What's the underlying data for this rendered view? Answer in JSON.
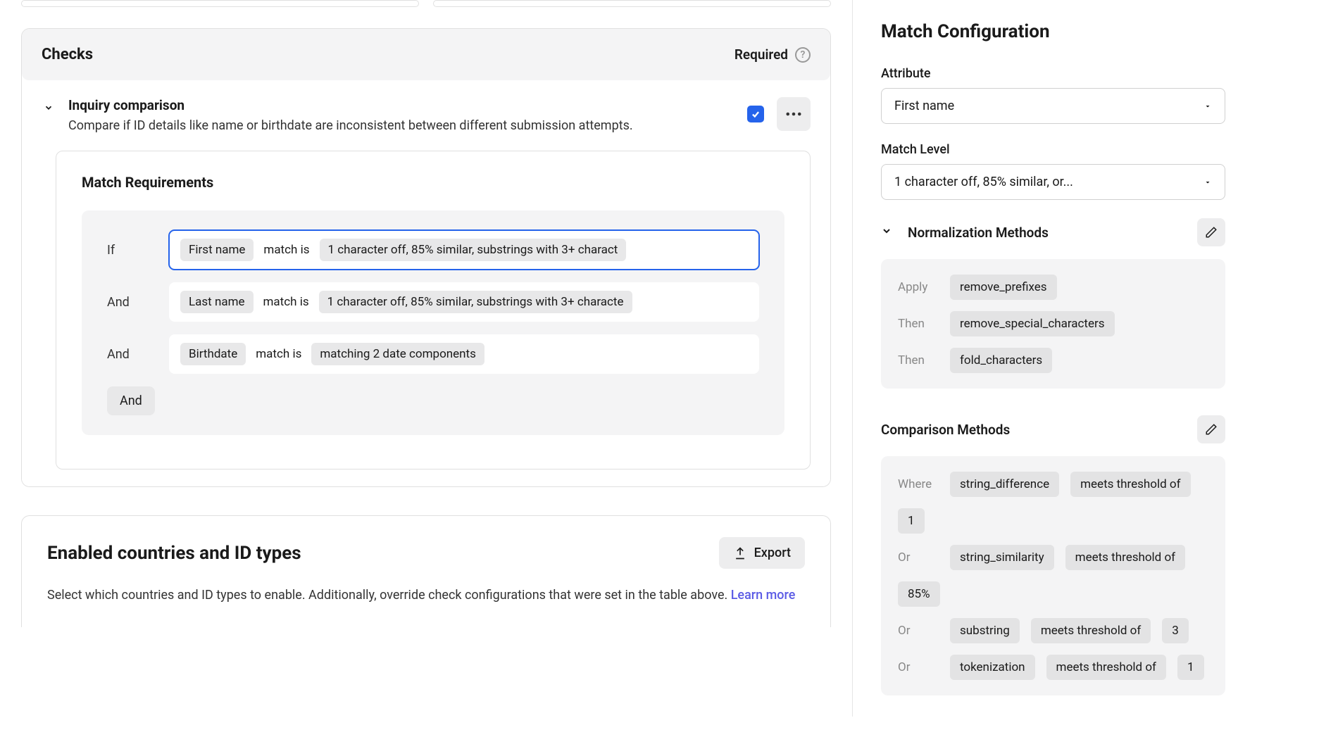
{
  "checks": {
    "header": "Checks",
    "required_label": "Required",
    "item": {
      "title": "Inquiry comparison",
      "description": "Compare if ID details like name or birthdate are inconsistent between different submission attempts."
    }
  },
  "match_requirements": {
    "title": "Match Requirements",
    "rows": [
      {
        "label": "If",
        "attr": "First name",
        "match_text": "match is",
        "detail": "1 character off, 85% similar, substrings with 3+ charact",
        "selected": true
      },
      {
        "label": "And",
        "attr": "Last name",
        "match_text": "match is",
        "detail": "1 character off, 85% similar, substrings with 3+ characte",
        "selected": false
      },
      {
        "label": "And",
        "attr": "Birthdate",
        "match_text": "match is",
        "detail": "matching 2 date components",
        "selected": false
      }
    ],
    "add_label": "And"
  },
  "countries": {
    "title": "Enabled countries and ID types",
    "export_label": "Export",
    "description": "Select which countries and ID types to enable. Additionally, override check configurations that were set in the table above. ",
    "learn_more": "Learn more"
  },
  "config": {
    "title": "Match Configuration",
    "attribute_label": "Attribute",
    "attribute_value": "First name",
    "match_level_label": "Match Level",
    "match_level_value": "1 character off, 85% similar, or...",
    "normalization_title": "Normalization Methods",
    "normalization_methods": [
      {
        "label": "Apply",
        "value": "remove_prefixes"
      },
      {
        "label": "Then",
        "value": "remove_special_characters"
      },
      {
        "label": "Then",
        "value": "fold_characters"
      }
    ],
    "comparison_title": "Comparison Methods",
    "comparison_methods": [
      {
        "label": "Where",
        "method": "string_difference",
        "threshold_text": "meets threshold of",
        "threshold": "1"
      },
      {
        "label": "Or",
        "method": "string_similarity",
        "threshold_text": "meets threshold of",
        "threshold": "85%"
      },
      {
        "label": "Or",
        "method": "substring",
        "threshold_text": "meets threshold of",
        "threshold": "3"
      },
      {
        "label": "Or",
        "method": "tokenization",
        "threshold_text": "meets threshold of",
        "threshold": "1"
      }
    ]
  }
}
